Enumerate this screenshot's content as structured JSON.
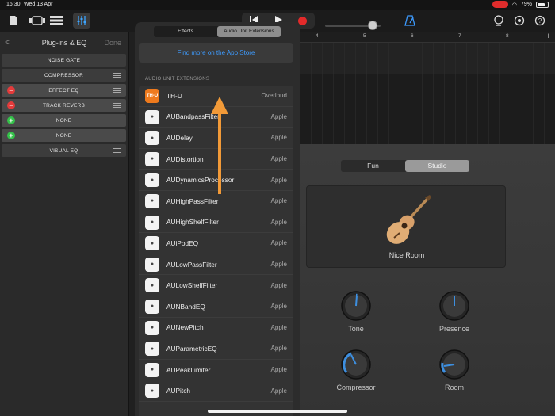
{
  "status": {
    "time": "16:30",
    "date": "Wed 13 Apr",
    "battery": "79%"
  },
  "toolbar": {
    "icons": [
      "document-icon",
      "browser-icon",
      "tracks-icon",
      "mixer-icon",
      "rewind-icon",
      "play-icon",
      "record-icon",
      "metronome-icon",
      "loop-icon",
      "settings-icon",
      "help-icon"
    ]
  },
  "left": {
    "back": "<",
    "title": "Plug-ins & EQ",
    "done": "Done",
    "slots": [
      "NOISE GATE",
      "COMPRESSOR",
      "EFFECT EQ",
      "TRACK REVERB",
      "NONE",
      "NONE",
      "VISUAL EQ"
    ]
  },
  "popover": {
    "tabs": [
      "Effects",
      "Audio Unit Extensions"
    ],
    "store_link": "Find more on the App Store",
    "section": "AUDIO UNIT EXTENSIONS",
    "items": [
      {
        "name": "TH-U",
        "vendor": "Overloud",
        "icon": "TH-U"
      },
      {
        "name": "AUBandpassFilter",
        "vendor": "Apple",
        "icon": ""
      },
      {
        "name": "AUDelay",
        "vendor": "Apple",
        "icon": ""
      },
      {
        "name": "AUDistortion",
        "vendor": "Apple",
        "icon": ""
      },
      {
        "name": "AUDynamicsProcessor",
        "vendor": "Apple",
        "icon": ""
      },
      {
        "name": "AUHighPassFilter",
        "vendor": "Apple",
        "icon": ""
      },
      {
        "name": "AUHighShelfFilter",
        "vendor": "Apple",
        "icon": ""
      },
      {
        "name": "AUiPodEQ",
        "vendor": "Apple",
        "icon": ""
      },
      {
        "name": "AULowPassFilter",
        "vendor": "Apple",
        "icon": ""
      },
      {
        "name": "AULowShelfFilter",
        "vendor": "Apple",
        "icon": ""
      },
      {
        "name": "AUNBandEQ",
        "vendor": "Apple",
        "icon": ""
      },
      {
        "name": "AUNewPitch",
        "vendor": "Apple",
        "icon": ""
      },
      {
        "name": "AUParametricEQ",
        "vendor": "Apple",
        "icon": ""
      },
      {
        "name": "AUPeakLimiter",
        "vendor": "Apple",
        "icon": ""
      },
      {
        "name": "AUPitch",
        "vendor": "Apple",
        "icon": ""
      }
    ]
  },
  "ruler": {
    "marks": [
      "4",
      "5",
      "6",
      "7",
      "8"
    ]
  },
  "amp": {
    "tabs": [
      "Fun",
      "Studio"
    ],
    "preset": "Nice Room",
    "knobs": [
      {
        "label": "Tone",
        "value": 0.52
      },
      {
        "label": "Presence",
        "value": 0.5
      },
      {
        "label": "Compressor",
        "value": 0.4
      },
      {
        "label": "Room",
        "value": 0.3
      }
    ]
  },
  "colors": {
    "accent": "#3d9bff",
    "record": "#e32a2a",
    "arrow": "#f29a38",
    "knob_arc": "#3d8fe0"
  }
}
